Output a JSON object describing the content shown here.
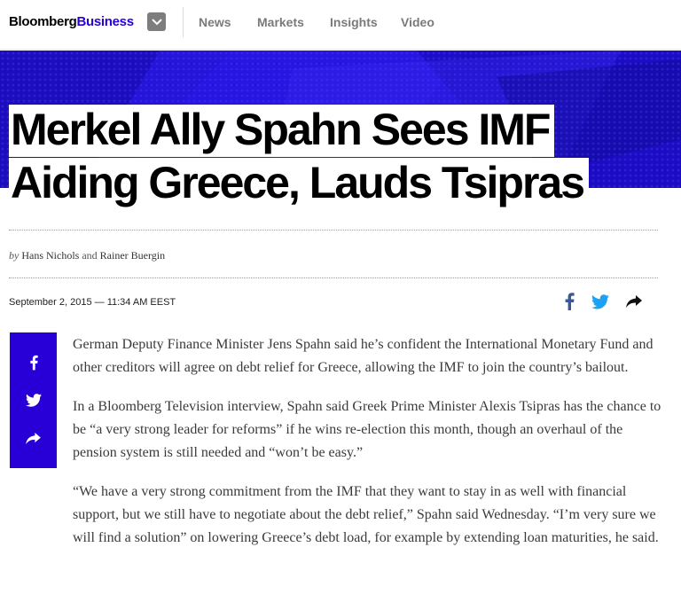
{
  "header": {
    "logo_part1": "Bloomberg",
    "logo_part2": "Business",
    "nav": [
      "News",
      "Markets",
      "Insights",
      "Video"
    ]
  },
  "article": {
    "headline_line1": "Merkel Ally Spahn Sees IMF",
    "headline_line2": "Aiding Greece, Lauds Tsipras",
    "byline": {
      "by": "by",
      "author1": "Hans Nichols",
      "and": "and",
      "author2": "Rainer Buergin"
    },
    "date": "September 2, 2015",
    "date_sep": "—",
    "time": "11:34 AM EEST",
    "paragraphs": [
      "German Deputy Finance Minister Jens Spahn said he’s confident the International Monetary Fund and other creditors will agree on debt relief for Greece, allowing the IMF to join the country’s bailout.",
      "In a Bloomberg Television interview, Spahn said Greek Prime Minister Alexis Tsipras has the chance to be “a very strong leader for reforms” if he wins re-election this month, though an overhaul of the pension system is still needed and “won’t be easy.”",
      "“We have a very strong commitment from the IMF that they want to stay in as well with financial support, but we still have to negotiate about the debt relief,” Spahn said Wednesday. “I’m very sure we will find a solution” on lowering Greece’s debt load, for example by extending loan maturities, he said."
    ]
  },
  "colors": {
    "brand_blue": "#2800d7",
    "facebook": "#3b5998",
    "twitter": "#1da1f2"
  },
  "icons": {
    "menu": "chevron-down-icon",
    "facebook": "facebook-icon",
    "twitter": "twitter-icon",
    "share": "share-arrow-icon"
  }
}
